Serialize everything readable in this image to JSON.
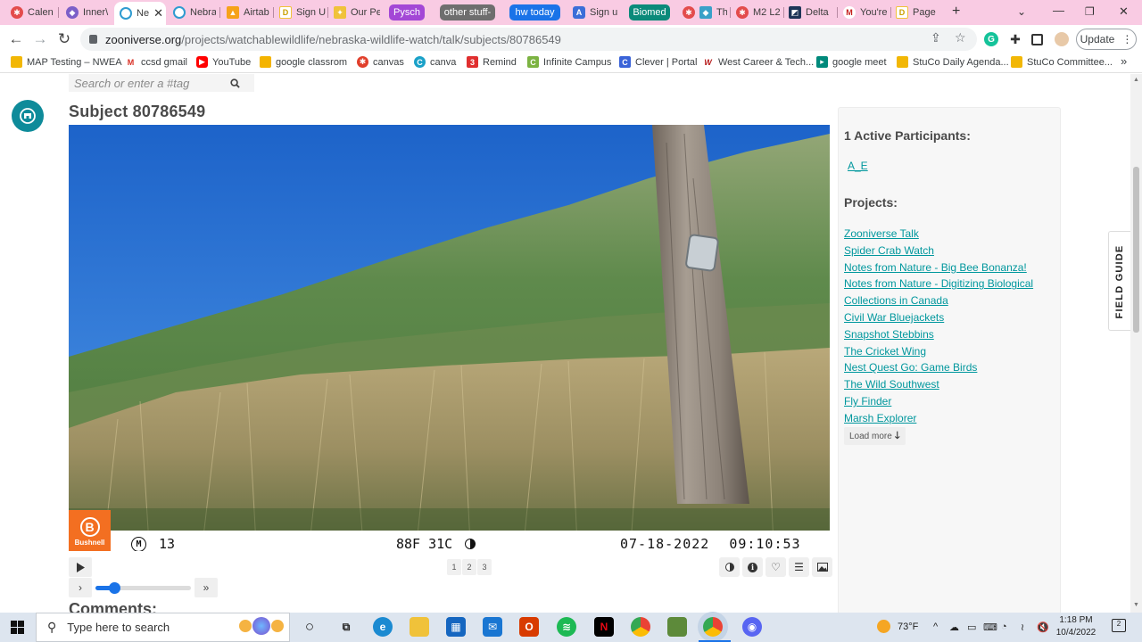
{
  "browser": {
    "tabs": [
      {
        "label": "Calen",
        "color": "#e34c4c"
      },
      {
        "label": "Inner\\",
        "color": "#7c5fc8"
      },
      {
        "label": "Ne",
        "color": "#2f9bd0",
        "active": true
      },
      {
        "label": "Nebra",
        "color": "#2f9bd0"
      },
      {
        "label": "Airtab",
        "color": "#f6a21a"
      },
      {
        "label": "Sign U",
        "color": "#f0c23a"
      },
      {
        "label": "Our Pe",
        "color": "#f0c23a"
      },
      {
        "label": "Sign u",
        "color": "#3b6ed8"
      },
      {
        "label": "Th",
        "color": "#e34c4c"
      },
      {
        "label": "M2 L2",
        "color": "#e34c4c"
      },
      {
        "label": "Delta",
        "color": "#1d3557"
      },
      {
        "label": "You're",
        "color": "#c5221f"
      },
      {
        "label": "Page",
        "color": "#f0c23a"
      }
    ],
    "tab_groups": [
      {
        "label": "Pysch",
        "color": "#a347d6"
      },
      {
        "label": "other stuff-",
        "color": "#6e6e6e"
      },
      {
        "label": "hw today",
        "color": "#1a73e8"
      },
      {
        "label": "Biomed",
        "color": "#0b8a7a"
      }
    ],
    "url_host": "zooniverse.org",
    "url_path": "/projects/watchablewildlife/nebraska-wildlife-watch/talk/subjects/80786549",
    "update_label": "Update",
    "bookmarks": [
      {
        "label": "MAP Testing – NWEA",
        "color": "#f2b705"
      },
      {
        "label": "ccsd gmail",
        "color": "#d93025"
      },
      {
        "label": "YouTube",
        "color": "#ff0000"
      },
      {
        "label": "google classrom",
        "color": "#f4b400"
      },
      {
        "label": "canvas",
        "color": "#e13f2b"
      },
      {
        "label": "canva",
        "color": "#1aa1c8"
      },
      {
        "label": "Remind",
        "color": "#e02f2f"
      },
      {
        "label": "Infinite Campus",
        "color": "#7cb342"
      },
      {
        "label": "Clever | Portal",
        "color": "#3a63d8"
      },
      {
        "label": "West Career & Tech...",
        "color": "#b71c1c"
      },
      {
        "label": "google meet",
        "color": "#00897b"
      },
      {
        "label": "StuCo Daily Agenda...",
        "color": "#f2b705"
      },
      {
        "label": "StuCo Committee...",
        "color": "#f2b705"
      }
    ]
  },
  "page": {
    "search_placeholder": "Search or enter a #tag",
    "subject_title": "Subject 80786549",
    "camera_overlay": {
      "brand": "Bushnell",
      "mode": "M",
      "frame": "13",
      "temperature": "88F 31C",
      "date": "07-18-2022",
      "time": "09:10:53"
    },
    "pages": [
      "1",
      "2",
      "3"
    ],
    "comments_heading": "Comments:",
    "field_guide": "FIELD GUIDE",
    "frame_slider": 0.2
  },
  "sidebar": {
    "participants_heading": "1 Active Participants:",
    "participant": "A_E",
    "projects_heading": "Projects:",
    "projects": [
      "Zooniverse Talk",
      "Spider Crab Watch",
      "Notes from Nature - Big Bee Bonanza!",
      "Notes from Nature - Digitizing Biological ",
      "Collections in Canada",
      "Civil War Bluejackets ",
      "Snapshot Stebbins",
      "The Cricket Wing",
      "Nest Quest Go: Game Birds",
      "The Wild Southwest",
      "Fly Finder",
      "Marsh Explorer"
    ],
    "load_more": "Load more"
  },
  "taskbar": {
    "search_placeholder": "Type here to search",
    "weather": "73°F",
    "time": "1:18 PM",
    "date": "10/4/2022"
  }
}
